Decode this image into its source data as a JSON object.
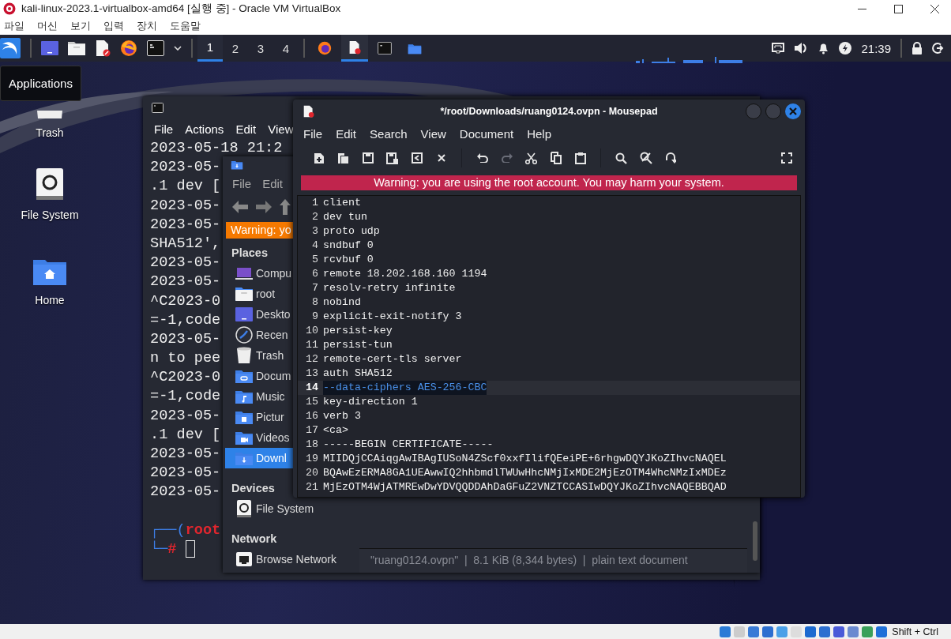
{
  "vbox": {
    "title": "kali-linux-2023.1-virtualbox-amd64 [실행 중] - Oracle VM VirtualBox",
    "menu": [
      "파일",
      "머신",
      "보기",
      "입력",
      "장치",
      "도움말"
    ],
    "hotkey": "Shift + Ctrl"
  },
  "panel": {
    "workspaces": [
      {
        "label": "1",
        "selected": true
      },
      {
        "label": "2",
        "selected": false
      },
      {
        "label": "3",
        "selected": false
      },
      {
        "label": "4",
        "selected": false
      }
    ],
    "tasks": [
      {
        "kind": "firefox",
        "selected": false
      },
      {
        "kind": "editor",
        "selected": true
      },
      {
        "kind": "terminal",
        "selected": false
      },
      {
        "kind": "folder",
        "selected": false
      }
    ],
    "clock": "21:39"
  },
  "tooltip": "Applications",
  "desktop_icons": [
    {
      "label": "Trash",
      "kind": "trash"
    },
    {
      "label": "File System",
      "kind": "drive"
    },
    {
      "label": "Home",
      "kind": "home"
    }
  ],
  "terminal": {
    "menu": [
      "File",
      "Actions",
      "Edit",
      "View"
    ],
    "lines": [
      "2023-05-18 21:2",
      "2023-05-",
      ".1 dev [",
      "2023-05-",
      "2023-05-",
      "SHA512',",
      "2023-05-",
      "2023-05-",
      "^C2023-0",
      "=-1,code",
      "2023-05-",
      "n to pee",
      "^C2023-0",
      "=-1,code",
      "2023-05-",
      ".1 dev [",
      "2023-05-",
      "2023-05-",
      "2023-05-"
    ],
    "prompt_top": "┌──(",
    "prompt_user": "root",
    "prompt_bottom": "└─",
    "prompt_symbol": "#"
  },
  "file_manager": {
    "menu": [
      "File",
      "Edit"
    ],
    "warning": "Warning: yo",
    "sections": [
      {
        "title": "Places",
        "items": [
          {
            "label": "Compu",
            "kind": "computer",
            "selected": false
          },
          {
            "label": "root",
            "kind": "home",
            "selected": false
          },
          {
            "label": "Deskto",
            "kind": "desktop",
            "selected": false
          },
          {
            "label": "Recen",
            "kind": "recent",
            "selected": false
          },
          {
            "label": "Trash",
            "kind": "trash",
            "selected": false
          },
          {
            "label": "Docum",
            "kind": "documents",
            "selected": false
          },
          {
            "label": "Music",
            "kind": "music",
            "selected": false
          },
          {
            "label": "Pictur",
            "kind": "pictures",
            "selected": false
          },
          {
            "label": "Videos",
            "kind": "videos",
            "selected": false
          },
          {
            "label": "Downl",
            "kind": "downloads",
            "selected": true
          }
        ]
      },
      {
        "title": "Devices",
        "items": [
          {
            "label": "File System",
            "kind": "drive",
            "selected": false
          }
        ]
      },
      {
        "title": "Network",
        "items": [
          {
            "label": "Browse Network",
            "kind": "network",
            "selected": false
          }
        ]
      }
    ],
    "status": "\"ruang0124.ovpn\"  |  8.1 KiB (8,344 bytes)  |  plain text document"
  },
  "editor": {
    "title": "*/root/Downloads/ruang0124.ovpn - Mousepad",
    "menu": [
      "File",
      "Edit",
      "Search",
      "View",
      "Document",
      "Help"
    ],
    "toolbar_groups": [
      {
        "buttons": [
          {
            "kind": "new",
            "disabled": false
          },
          {
            "kind": "new-window",
            "disabled": false
          },
          {
            "kind": "save",
            "disabled": false
          },
          {
            "kind": "save-as",
            "disabled": false
          },
          {
            "kind": "reload",
            "disabled": false
          },
          {
            "kind": "close",
            "disabled": false
          }
        ]
      },
      {
        "buttons": [
          {
            "kind": "undo",
            "disabled": false
          },
          {
            "kind": "redo",
            "disabled": true
          },
          {
            "kind": "cut",
            "disabled": false
          },
          {
            "kind": "copy",
            "disabled": false
          },
          {
            "kind": "paste",
            "disabled": false
          }
        ]
      },
      {
        "buttons": [
          {
            "kind": "search",
            "disabled": false
          },
          {
            "kind": "replace",
            "disabled": false
          },
          {
            "kind": "goto",
            "disabled": false
          }
        ]
      }
    ],
    "warning": "Warning: you are using the root account. You may harm your system.",
    "lines": [
      {
        "number": "1",
        "text": "client",
        "current": false
      },
      {
        "number": "2",
        "text": "dev tun",
        "current": false
      },
      {
        "number": "3",
        "text": "proto udp",
        "current": false
      },
      {
        "number": "4",
        "text": "sndbuf 0",
        "current": false
      },
      {
        "number": "5",
        "text": "rcvbuf 0",
        "current": false
      },
      {
        "number": "6",
        "text": "remote 18.202.168.160 1194",
        "current": false
      },
      {
        "number": "7",
        "text": "resolv-retry infinite",
        "current": false
      },
      {
        "number": "8",
        "text": "nobind",
        "current": false
      },
      {
        "number": "9",
        "text": "explicit-exit-notify 3",
        "current": false
      },
      {
        "number": "10",
        "text": "persist-key",
        "current": false
      },
      {
        "number": "11",
        "text": "persist-tun",
        "current": false
      },
      {
        "number": "12",
        "text": "remote-cert-tls server",
        "current": false
      },
      {
        "number": "13",
        "text": "auth SHA512",
        "current": false
      },
      {
        "number": "14",
        "text": "--data-ciphers AES-256-CBC",
        "current": true
      },
      {
        "number": "15",
        "text": "key-direction 1",
        "current": false
      },
      {
        "number": "16",
        "text": "verb 3",
        "current": false
      },
      {
        "number": "17",
        "text": "<ca>",
        "current": false
      },
      {
        "number": "18",
        "text": "-----BEGIN CERTIFICATE-----",
        "current": false
      },
      {
        "number": "19",
        "text": "MIIDQjCCAiqgAwIBAgIUSoN4ZScf0xxfIlifQEeiPE+6rhgwDQYJKoZIhvcNAQEL",
        "current": false
      },
      {
        "number": "20",
        "text": "BQAwEzERMA8GA1UEAwwIQ2hhbmdlTWUwHhcNMjIxMDE2MjEzOTM4WhcNMzIxMDEz",
        "current": false
      },
      {
        "number": "21",
        "text": "MjEzOTM4WjATMREwDwYDVQQDDAhDaGFuZ2VNZTCCASIwDQYJKoZIhvcNAQEBBQAD",
        "current": false
      }
    ]
  }
}
